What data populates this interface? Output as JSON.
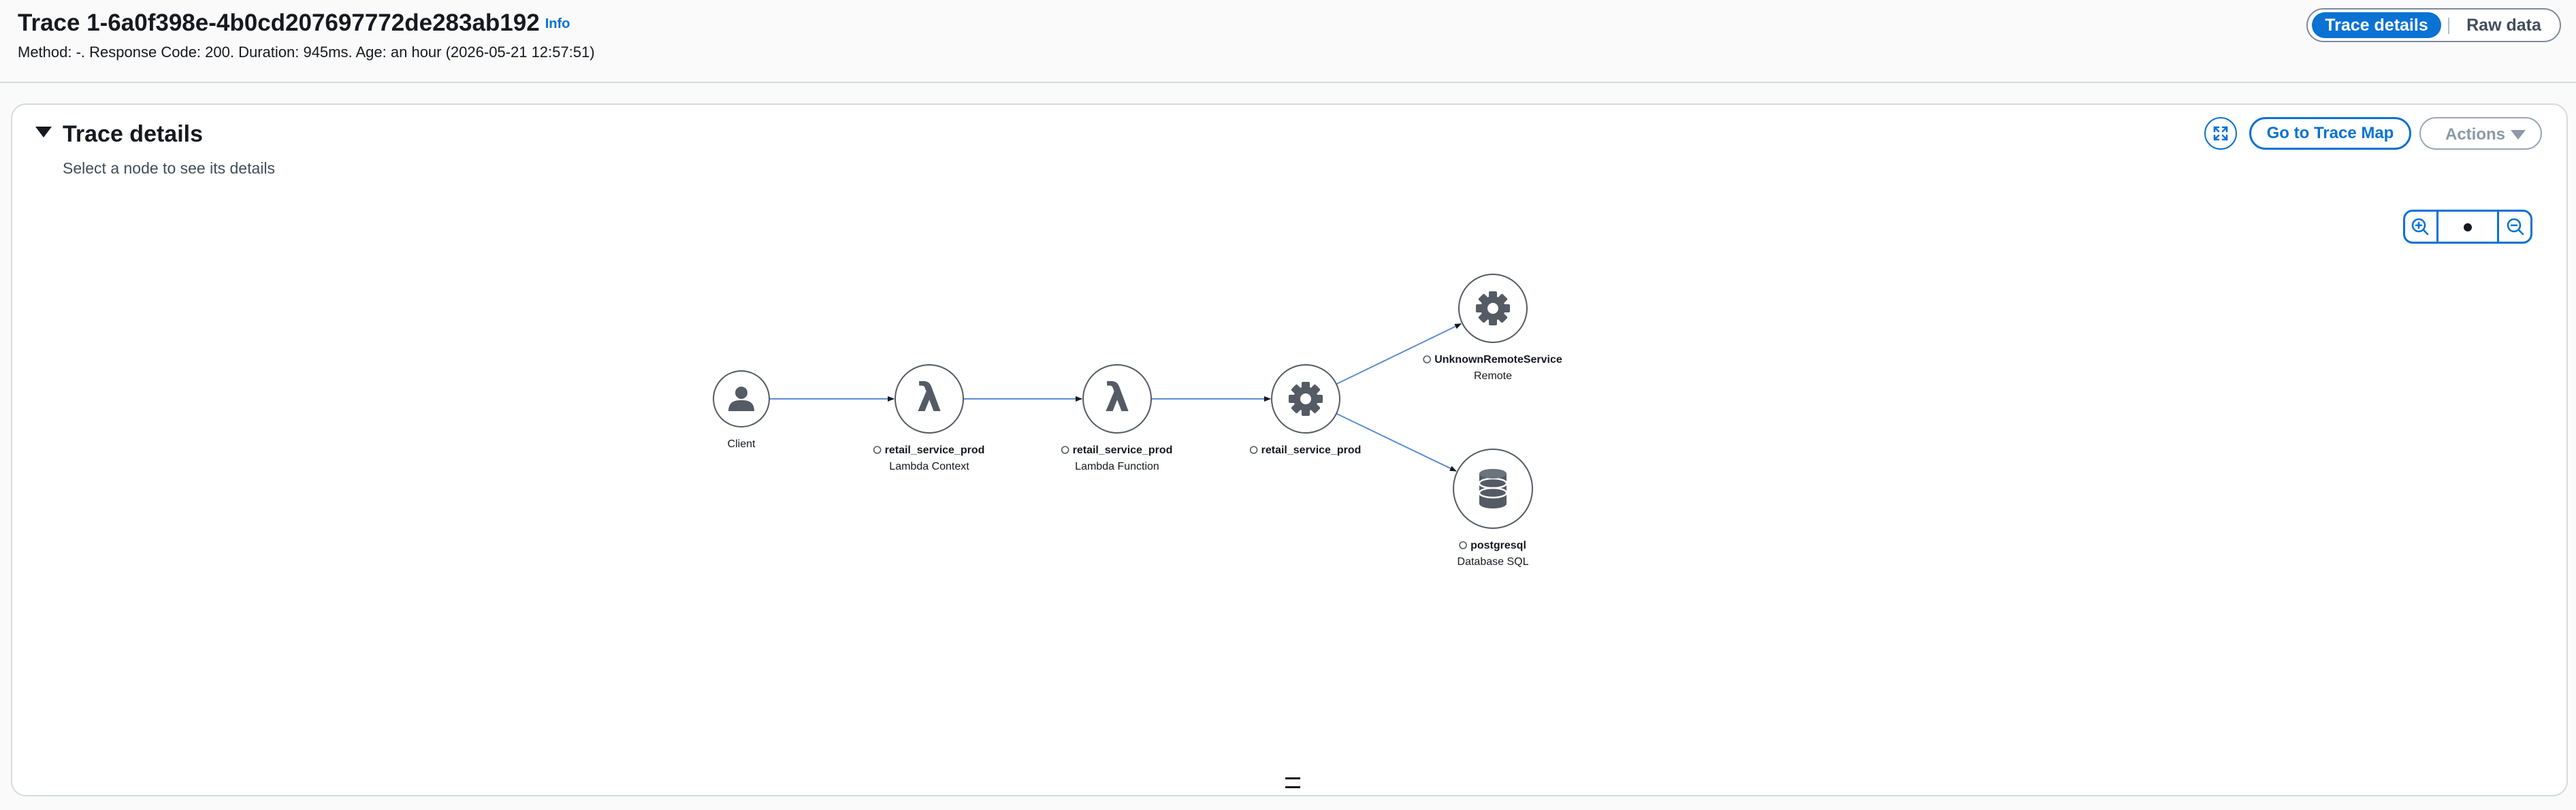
{
  "header": {
    "title": "Trace 1-6a0f398e-4b0cd207697772de283ab192",
    "info": "Info",
    "subline": "Method: -. Response Code: 200. Duration: 945ms. Age: an hour (2026-05-21 12:57:51)",
    "tabs": [
      {
        "label": "Trace details",
        "active": true
      },
      {
        "label": "Raw data",
        "active": false
      }
    ]
  },
  "panel": {
    "title": "Trace details",
    "description": "Select a node to see its details",
    "go_to_map": "Go to Trace Map",
    "actions": "Actions"
  },
  "graph": {
    "accent": "#0972d3",
    "edge_color": "#5b8ed0",
    "nodes": [
      {
        "id": "client",
        "icon": "user-icon",
        "name": "Client",
        "type": ""
      },
      {
        "id": "lambda-context",
        "icon": "lambda-icon",
        "name": "retail_service_prod",
        "type": "Lambda Context"
      },
      {
        "id": "lambda-function",
        "icon": "lambda-icon",
        "name": "retail_service_prod",
        "type": "Lambda Function"
      },
      {
        "id": "service",
        "icon": "gear-icon",
        "name": "retail_service_prod",
        "type": ""
      },
      {
        "id": "remote",
        "icon": "gear-icon",
        "name": "UnknownRemoteService",
        "type": "Remote"
      },
      {
        "id": "database",
        "icon": "database-icon",
        "name": "postgresql",
        "type": "Database SQL"
      }
    ],
    "edges": [
      [
        "client",
        "lambda-context"
      ],
      [
        "lambda-context",
        "lambda-function"
      ],
      [
        "lambda-function",
        "service"
      ],
      [
        "service",
        "remote"
      ],
      [
        "service",
        "database"
      ]
    ]
  }
}
